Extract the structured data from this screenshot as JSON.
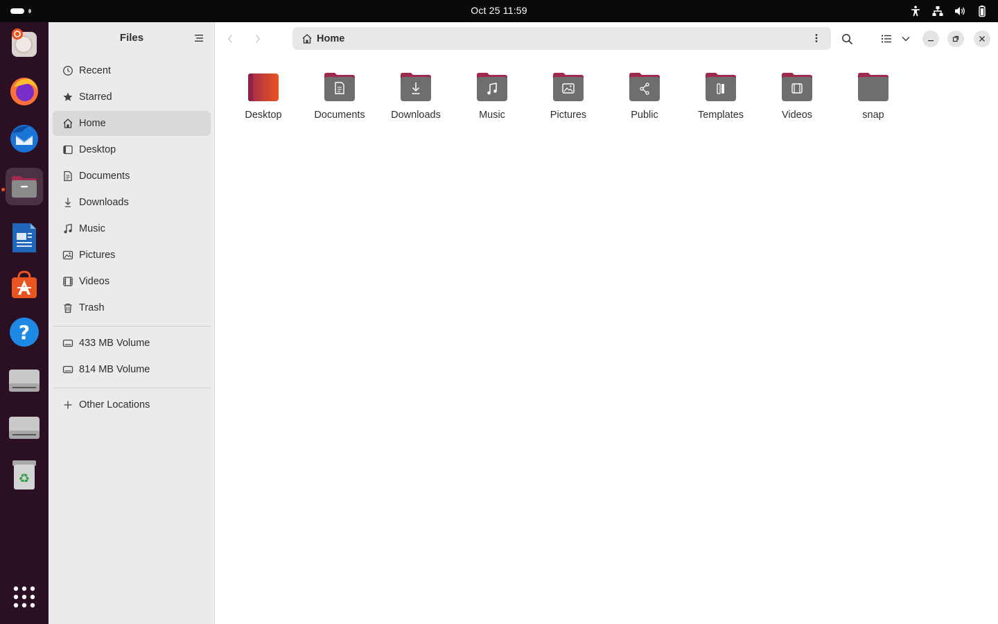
{
  "topbar": {
    "clock": "Oct 25  11:59"
  },
  "dock": {
    "apps": [
      "Image Viewer",
      "Firefox",
      "Thunderbird",
      "Files",
      "LibreOffice Writer",
      "App Center",
      "Help",
      "Drive",
      "Drive",
      "Trash"
    ]
  },
  "sidebar": {
    "title": "Files",
    "places": [
      {
        "label": "Recent",
        "icon": "clock-icon"
      },
      {
        "label": "Starred",
        "icon": "star-icon"
      },
      {
        "label": "Home",
        "icon": "home-icon"
      },
      {
        "label": "Desktop",
        "icon": "desktop-icon"
      },
      {
        "label": "Documents",
        "icon": "document-icon"
      },
      {
        "label": "Downloads",
        "icon": "download-icon"
      },
      {
        "label": "Music",
        "icon": "music-icon"
      },
      {
        "label": "Pictures",
        "icon": "picture-icon"
      },
      {
        "label": "Videos",
        "icon": "video-icon"
      },
      {
        "label": "Trash",
        "icon": "trash-icon"
      }
    ],
    "selected": "Home",
    "volumes": [
      {
        "label": "433 MB Volume",
        "icon": "drive-icon"
      },
      {
        "label": "814 MB Volume",
        "icon": "drive-icon"
      }
    ],
    "other": {
      "label": "Other Locations",
      "icon": "plus-icon"
    }
  },
  "pathbar": {
    "location": "Home"
  },
  "files": [
    {
      "name": "Desktop",
      "icon": "desktop-folder-icon"
    },
    {
      "name": "Documents",
      "icon": "documents-folder-icon"
    },
    {
      "name": "Downloads",
      "icon": "downloads-folder-icon"
    },
    {
      "name": "Music",
      "icon": "music-folder-icon"
    },
    {
      "name": "Pictures",
      "icon": "pictures-folder-icon"
    },
    {
      "name": "Public",
      "icon": "public-folder-icon"
    },
    {
      "name": "Templates",
      "icon": "templates-folder-icon"
    },
    {
      "name": "Videos",
      "icon": "videos-folder-icon"
    },
    {
      "name": "snap",
      "icon": "folder-icon"
    }
  ],
  "colors": {
    "accent": "#e95420",
    "folder_top": "#a0294e",
    "folder_body": "#6e6e6e"
  }
}
